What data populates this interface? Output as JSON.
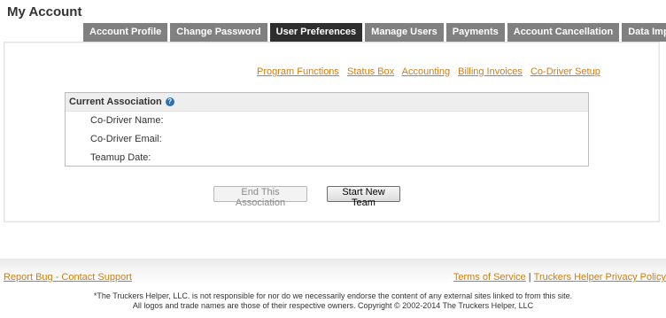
{
  "page": {
    "title": "My Account"
  },
  "tabs": [
    {
      "label": "Account Profile"
    },
    {
      "label": "Change Password"
    },
    {
      "label": "User Preferences"
    },
    {
      "label": "Manage Users"
    },
    {
      "label": "Payments"
    },
    {
      "label": "Account Cancellation"
    },
    {
      "label": "Data Import"
    }
  ],
  "active_tab": "User Preferences",
  "sublinks": [
    {
      "label": "Program Functions"
    },
    {
      "label": "Status Box"
    },
    {
      "label": "Accounting"
    },
    {
      "label": "Billing Invoices"
    },
    {
      "label": "Co-Driver Setup"
    }
  ],
  "association": {
    "title": "Current Association",
    "info_icon": "info-icon",
    "fields": {
      "name": "Co-Driver Name:",
      "email": "Co-Driver Email:",
      "teamup": "Teamup Date:"
    }
  },
  "buttons": {
    "end": "End This Association",
    "start": "Start New Team"
  },
  "footer": {
    "report": "Report Bug - Contact Support",
    "terms": "Terms of Service",
    "separator": "|",
    "privacy": "Truckers Helper Privacy Policy",
    "disclaimer1": "*The Truckers Helper, LLC. is not responsible for nor do we necessarily endorse the content of any external sites linked to from this site.",
    "disclaimer2": "All logos and trade names are those of their respective owners. Copyright © 2002-2014 The Truckers Helper, LLC"
  },
  "colors": {
    "link": "#d07d12",
    "tab": "#808080",
    "tab_active": "#2e2e2e",
    "info_icon": "#2b6fb6"
  }
}
